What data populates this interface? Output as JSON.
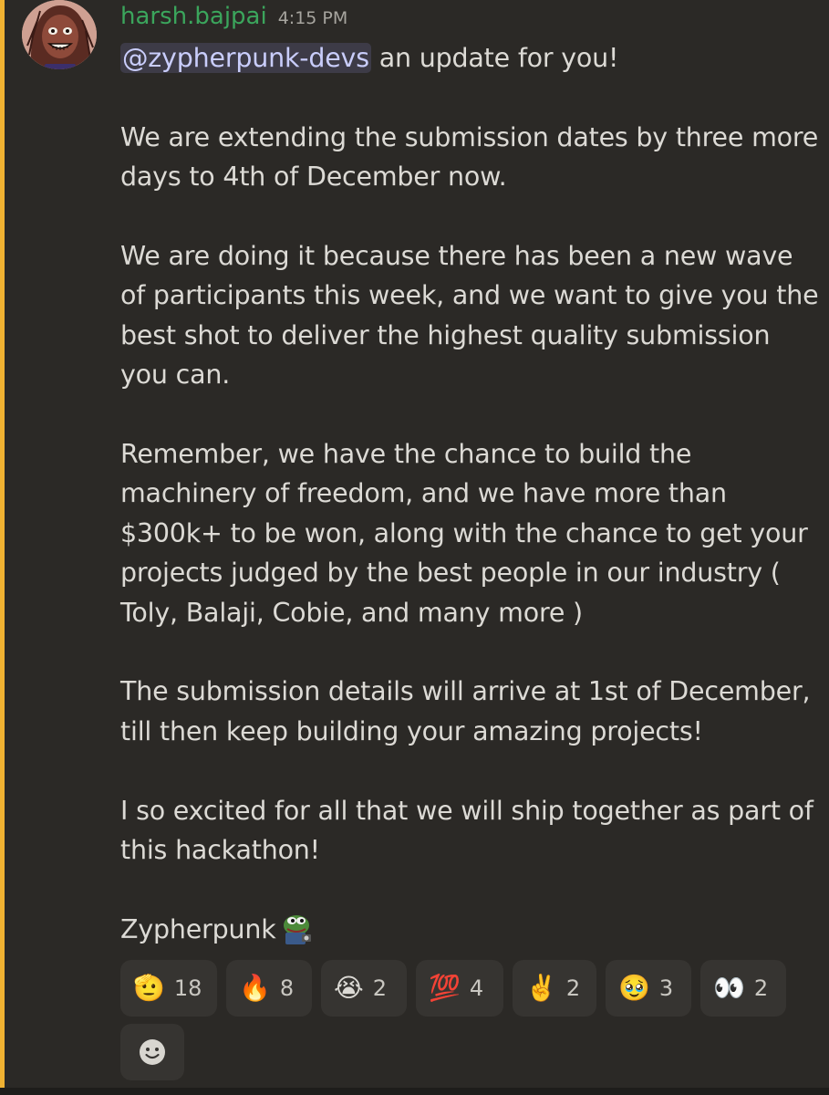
{
  "message": {
    "author": "harsh.bajpai",
    "timestamp": "4:15 PM",
    "mention": "@zypherpunk-devs",
    "first_line_rest": " an update for you!",
    "paragraphs": [
      "We are extending the submission dates by three more days to 4th of December now.",
      "We are doing it because there has been a new wave of participants this week, and we want to give you the best shot to deliver the highest quality submission you can.",
      "Remember, we have the chance to build the machinery of freedom, and we have more than $300k+ to be won, along with the chance to get your projects judged by the best people in our industry ( Toly, Balaji, Cobie, and many more )",
      "The submission details will arrive at 1st of December, till then keep building your amazing projects!",
      "I so excited for all that we will ship together as part of this hackathon!"
    ],
    "signature": "Zypherpunk",
    "signature_emoji": "pepe-emoji"
  },
  "reactions": [
    {
      "emoji": "🫡",
      "icon": "saluting-face-icon",
      "count": "18"
    },
    {
      "emoji": "🔥",
      "icon": "fire-icon",
      "count": "8"
    },
    {
      "emoji": "😭",
      "icon": "crying-face-icon",
      "count": "2"
    },
    {
      "emoji": "💯",
      "icon": "hundred-points-icon",
      "count": "4"
    },
    {
      "emoji": "✌️",
      "icon": "victory-hand-icon",
      "count": "2"
    },
    {
      "emoji": "🥹",
      "icon": "holding-back-tears-icon",
      "count": "3"
    },
    {
      "emoji": "👀",
      "icon": "eyes-icon",
      "count": "2"
    }
  ],
  "add_reaction_icon": "add-reaction-icon",
  "colors": {
    "background": "#2b2926",
    "accent": "#f0b232",
    "username": "#3ba55c",
    "mention_bg": "#3d3b47",
    "mention_text": "#c9cdfb"
  }
}
